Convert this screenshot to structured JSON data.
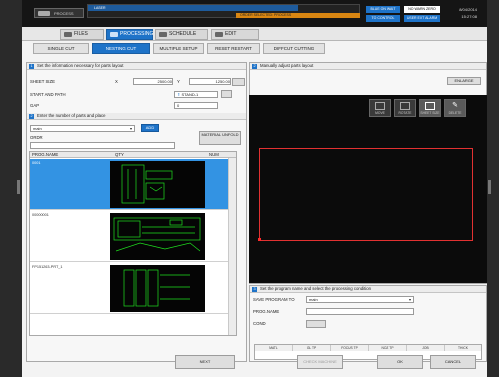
{
  "topbar": {
    "mode_label": "PROCESS",
    "status_top": "LASER",
    "status_bottom": "ORDER SELECTED: PROCESS",
    "btn1": "BLUE ON WAIT",
    "btn2": "NO WARN ZERO",
    "btn3": "TO CONTROL",
    "btn4": "USER EXT ALARM",
    "corner_line1": "8/04/2014",
    "corner_line2": "15:27:08"
  },
  "main_tabs": [
    "FILES",
    "PROCESSING",
    "SCHEDULE",
    "EDIT"
  ],
  "sub_tabs": [
    "SINGLE CUT",
    "NESTING CUT",
    "MULTIPLE SETUP",
    "RESET RESTART",
    "DIFFCUT CUTTING"
  ],
  "section1": {
    "step": "1",
    "title": "Set the information necessary for parts layout",
    "sheet_size_label": "SHEET SIZE",
    "x_label": "X",
    "x_value": "2500.00",
    "y_label": "Y",
    "y_value": "1250.00",
    "start_path_label": "START AND PATH",
    "start_path_value": "STAND-1",
    "gap_label": "GAP",
    "gap_value": "0"
  },
  "section2": {
    "step": "2",
    "title": "Enter the number of parts and place",
    "dropdown_value": "main",
    "add_label": "ADD",
    "order_label": "ORDR",
    "material_label": "MATERIAL UNFOLD",
    "col_name": "PROG.NAME",
    "col_qty": "QTY",
    "col_num": "NUM",
    "rows": [
      {
        "name": "0001",
        "selected": true
      },
      {
        "name": "00000001",
        "selected": false
      },
      {
        "name": "FP151263-PRT_1",
        "selected": false
      }
    ]
  },
  "section_view": {
    "step": "2",
    "title": "Manually adjust parts layout",
    "enlarge_label": "ENLARGE",
    "tools": [
      "MOVE",
      "ROTATE",
      "SHEET SIZE",
      "DELETE"
    ]
  },
  "section3": {
    "step": "3",
    "title": "Set the program name and select the processing condition",
    "save_program_label": "SAVE PROGRAM TO",
    "save_program_value": "main",
    "prog_name_label": "PROG.NAME",
    "prog_name_value": "",
    "cond_label": "COND",
    "table_headers": [
      "MATL",
      "GL TP",
      "FOCUS TP",
      "NOZ TP",
      "JOB",
      "THICK"
    ]
  },
  "footer": {
    "next_label": "NEXT",
    "check_label": "CHECK MACHINE",
    "ok_label": "OK",
    "cancel_label": "CANCEL"
  }
}
